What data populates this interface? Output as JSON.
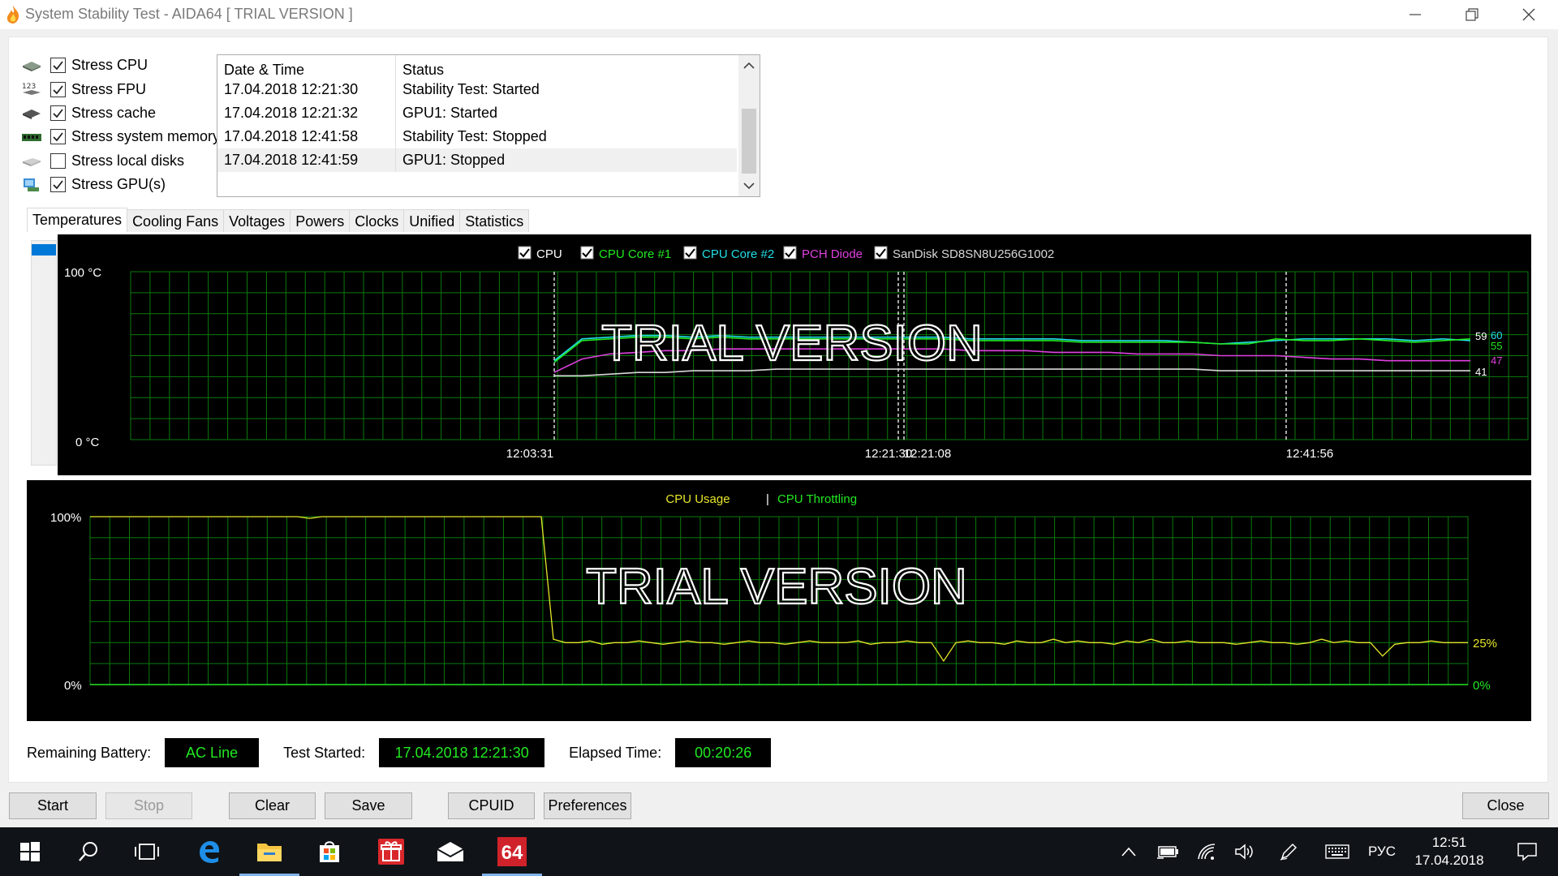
{
  "window": {
    "title": "System Stability Test - AIDA64  [ TRIAL VERSION ]"
  },
  "stress_options": [
    {
      "label": "Stress CPU",
      "checked": true,
      "icon": "cpu-icon"
    },
    {
      "label": "Stress FPU",
      "checked": true,
      "icon": "fpu-icon"
    },
    {
      "label": "Stress cache",
      "checked": true,
      "icon": "cache-icon"
    },
    {
      "label": "Stress system memory",
      "checked": true,
      "icon": "memory-icon"
    },
    {
      "label": "Stress local disks",
      "checked": false,
      "icon": "disk-icon"
    },
    {
      "label": "Stress GPU(s)",
      "checked": true,
      "icon": "gpu-icon"
    }
  ],
  "log": {
    "headers": {
      "datetime": "Date & Time",
      "status": "Status"
    },
    "rows": [
      {
        "datetime": "17.04.2018 12:21:30",
        "status": "Stability Test: Started"
      },
      {
        "datetime": "17.04.2018 12:21:32",
        "status": "GPU1: Started"
      },
      {
        "datetime": "17.04.2018 12:41:58",
        "status": "Stability Test: Stopped"
      },
      {
        "datetime": "17.04.2018 12:41:59",
        "status": "GPU1: Stopped"
      }
    ]
  },
  "tabs": [
    "Temperatures",
    "Cooling Fans",
    "Voltages",
    "Powers",
    "Clocks",
    "Unified",
    "Statistics"
  ],
  "active_tab": "Temperatures",
  "colors": {
    "grid": "#0c7a0c",
    "cpu": "#ffffff",
    "core1": "#22e822",
    "core2": "#21dfe6",
    "pch": "#e040e0",
    "ssd": "#d8d8d8",
    "usage": "#e6e62a",
    "throttling": "#22e822"
  },
  "chart_data": [
    {
      "type": "line",
      "legend": [
        {
          "name": "CPU",
          "color": "#ffffff"
        },
        {
          "name": "CPU Core #1",
          "color": "#22e822"
        },
        {
          "name": "CPU Core #2",
          "color": "#21dfe6"
        },
        {
          "name": "PCH Diode",
          "color": "#e040e0"
        },
        {
          "name": "SanDisk SD8SN8U256G1002",
          "color": "#d8d8d8"
        }
      ],
      "y_top_label": "100 °C",
      "y_bottom_label": "0 °C",
      "ylim": [
        0,
        100
      ],
      "x_ticks": [
        "12:03:31",
        "12:21:30",
        "12:21:08",
        "12:41:56"
      ],
      "end_values": [
        "59",
        "60",
        "55",
        "47",
        "41"
      ],
      "watermark": "TRIAL VERSION",
      "series": [
        {
          "name": "CPU Core #2",
          "values": [
            0,
            0,
            0,
            0,
            0,
            0,
            47,
            60,
            61,
            62,
            62,
            61,
            62,
            61,
            61,
            61,
            61,
            61,
            61,
            61,
            61,
            60,
            60,
            60,
            60,
            59,
            59,
            59,
            59,
            58,
            57,
            58,
            59,
            60,
            60,
            60,
            60,
            59,
            60,
            59
          ]
        },
        {
          "name": "CPU Core #1",
          "values": [
            0,
            0,
            0,
            0,
            0,
            0,
            46,
            59,
            60,
            61,
            61,
            60,
            61,
            60,
            60,
            60,
            60,
            60,
            60,
            60,
            60,
            59,
            59,
            59,
            59,
            58,
            58,
            58,
            58,
            58,
            57,
            57,
            60,
            59,
            59,
            60,
            59,
            58,
            59,
            60
          ]
        },
        {
          "name": "PCH Diode",
          "values": [
            0,
            0,
            0,
            0,
            0,
            0,
            40,
            48,
            51,
            52,
            53,
            53,
            54,
            54,
            54,
            54,
            54,
            54,
            54,
            54,
            54,
            53,
            53,
            53,
            52,
            52,
            52,
            51,
            51,
            51,
            50,
            50,
            50,
            49,
            48,
            48,
            47,
            47,
            47,
            47
          ]
        },
        {
          "name": "SanDisk SD8SN8U256G1002",
          "values": [
            0,
            0,
            0,
            0,
            0,
            0,
            38,
            38,
            39,
            40,
            40,
            41,
            41,
            41,
            42,
            42,
            42,
            42,
            42,
            42,
            42,
            42,
            42,
            42,
            42,
            42,
            42,
            42,
            42,
            42,
            41,
            41,
            41,
            41,
            41,
            41,
            41,
            41,
            41,
            41
          ]
        }
      ]
    },
    {
      "type": "line",
      "legend": [
        {
          "name": "CPU Usage",
          "color": "#e6e62a"
        },
        {
          "name": "CPU Throttling",
          "color": "#22e822"
        }
      ],
      "legend_separator": "|",
      "y_top_label": "100%",
      "y_bottom_label": "0%",
      "ylim": [
        0,
        100
      ],
      "end_values": [
        "25%",
        "0%"
      ],
      "watermark": "TRIAL VERSION",
      "series": [
        {
          "name": "CPU Usage",
          "values": [
            100,
            100,
            100,
            100,
            100,
            100,
            100,
            100,
            100,
            100,
            100,
            100,
            100,
            100,
            100,
            100,
            100,
            100,
            99,
            100,
            100,
            100,
            100,
            100,
            100,
            100,
            100,
            100,
            100,
            100,
            100,
            100,
            100,
            100,
            100,
            100,
            100,
            100,
            27,
            25,
            25,
            26,
            24,
            25,
            25,
            26,
            25,
            24,
            25,
            26,
            25,
            25,
            24,
            25,
            26,
            25,
            25,
            24,
            25,
            26,
            25,
            25,
            25,
            26,
            24,
            25,
            25,
            26,
            25,
            25,
            14,
            25,
            26,
            25,
            25,
            24,
            26,
            25,
            25,
            27,
            25,
            26,
            25,
            25,
            24,
            26,
            25,
            27,
            25,
            25,
            26,
            25,
            25,
            25,
            24,
            25,
            26,
            25,
            25,
            24,
            25,
            27,
            25,
            26,
            25,
            25,
            17,
            24,
            25,
            25,
            26,
            25,
            25,
            25
          ]
        },
        {
          "name": "CPU Throttling",
          "values": [
            0,
            0,
            0,
            0,
            0,
            0,
            0,
            0,
            0,
            0
          ]
        }
      ]
    }
  ],
  "status": {
    "battery_label": "Remaining Battery:",
    "battery_value": "AC Line",
    "started_label": "Test Started:",
    "started_value": "17.04.2018 12:21:30",
    "elapsed_label": "Elapsed Time:",
    "elapsed_value": "00:20:26"
  },
  "buttons": {
    "start": "Start",
    "stop": "Stop",
    "clear": "Clear",
    "save": "Save",
    "cpuid": "CPUID",
    "preferences": "Preferences",
    "close": "Close"
  },
  "taskbar": {
    "lang": "РУС",
    "time": "12:51",
    "date": "17.04.2018",
    "aida_label": "64"
  }
}
